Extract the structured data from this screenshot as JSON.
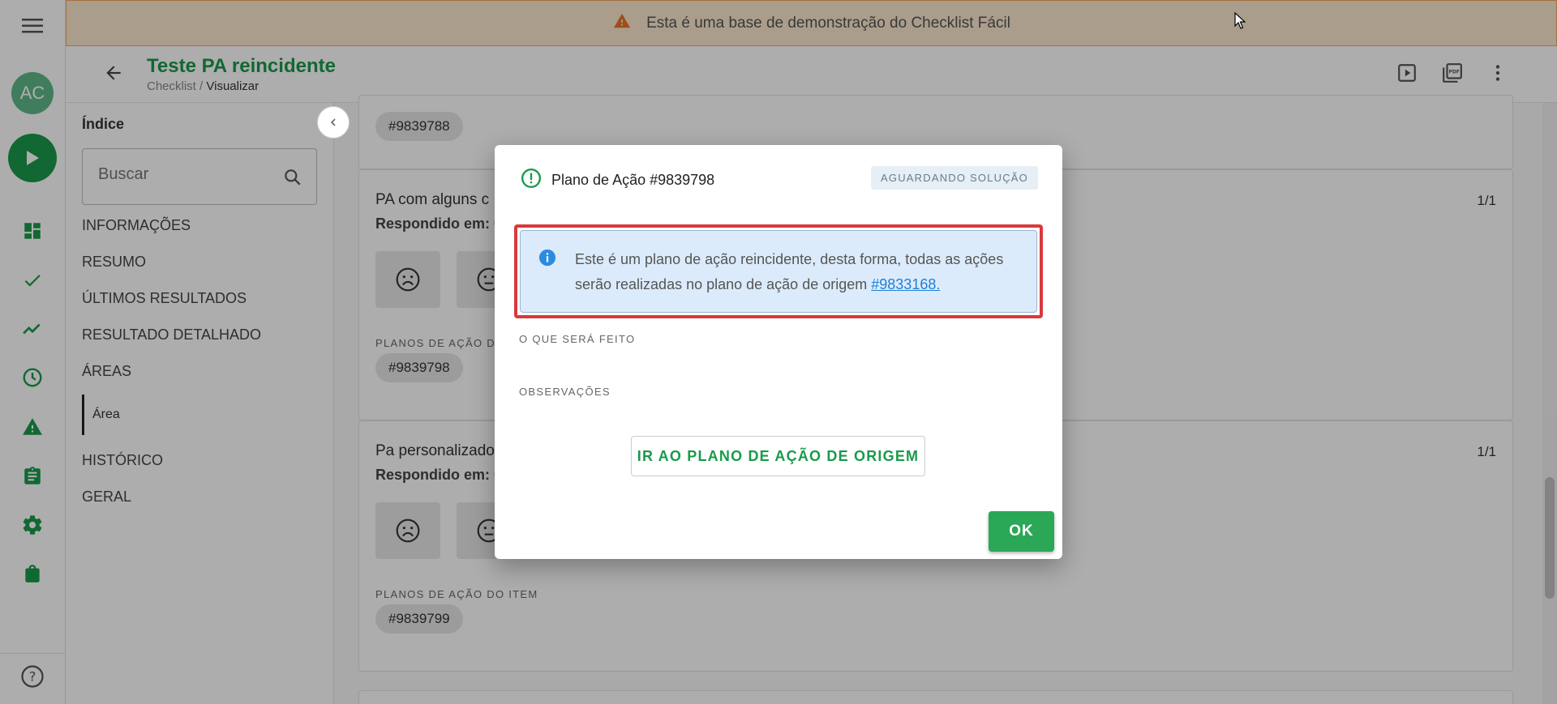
{
  "banner": {
    "text": "Esta é uma base de demonstração do Checklist Fácil"
  },
  "rail": {
    "avatar_initials": "AC"
  },
  "header": {
    "title": "Teste PA reincidente",
    "breadcrumb_root": "Checklist",
    "breadcrumb_separator": "/",
    "breadcrumb_current": "Visualizar"
  },
  "index": {
    "title": "Índice",
    "search_placeholder": "Buscar",
    "items": [
      "INFORMAÇÕES",
      "RESUMO",
      "ÚLTIMOS RESULTADOS",
      "RESULTADO DETALHADO",
      "ÁREAS"
    ],
    "sub_item": "Área",
    "items_after": [
      "HISTÓRICO",
      "GERAL"
    ]
  },
  "content": {
    "top_chip": "#9839788",
    "questions": [
      {
        "title": "PA com alguns c",
        "answered_label": "Respondido em: 0",
        "count": "1/1",
        "plans_label": "PLANOS DE AÇÃO DO",
        "plan_chip": "#9839798"
      },
      {
        "title": "Pa personalizado",
        "answered_label": "Respondido em: 0",
        "count": "1/1",
        "plans_label": "PLANOS DE AÇÃO DO ITEM",
        "plan_chip": "#9839799"
      }
    ]
  },
  "modal": {
    "title": "Plano de Ação #9839798",
    "status": "AGUARDANDO SOLUÇÃO",
    "alert_text": "Este é um plano de ação reincidente, desta forma, todas as ações serão realizadas no plano de ação de origem",
    "alert_link": "#9833168.",
    "what_label": "O QUE SERÁ FEITO",
    "notes_label": "OBSERVAÇÕES",
    "origin_button": "IR AO PLANO DE AÇÃO DE ORIGEM",
    "ok_button": "OK"
  },
  "colors": {
    "brand_green": "#1a9a4b",
    "ok_green": "#2aa857",
    "banner_bg": "#fde7cf",
    "alert_bg": "#dcebfb",
    "highlight_red": "#d9393d",
    "link_blue": "#1e7fd8"
  },
  "icons": {
    "rail": [
      "menu-icon",
      "play-icon",
      "dashboard-icon",
      "check-icon",
      "trending-icon",
      "clock-icon",
      "warning-icon",
      "clipboard-icon",
      "gear-icon",
      "shopping-bag-icon",
      "help-icon"
    ],
    "header": [
      "arrow-left-icon",
      "play-box-icon",
      "pdf-icon",
      "more-vertical-icon"
    ]
  }
}
